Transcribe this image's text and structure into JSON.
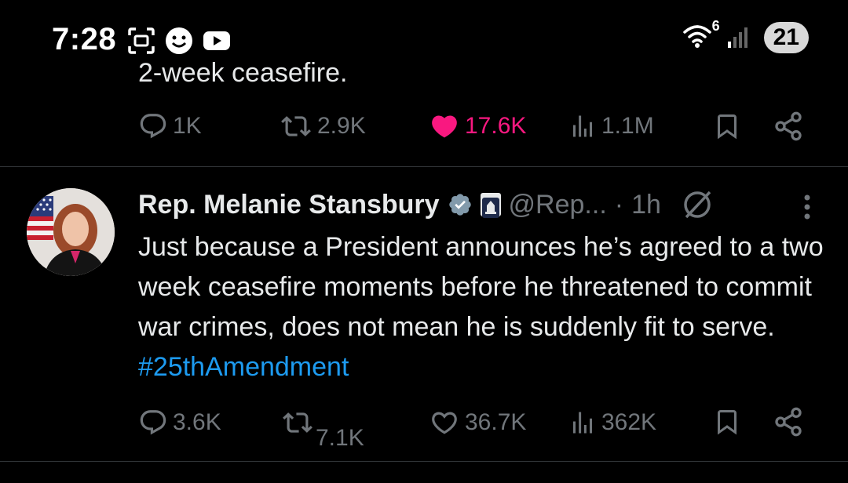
{
  "status_bar": {
    "time": "7:28",
    "wifi_label": "6",
    "battery": "21"
  },
  "previous_tweet": {
    "text_fragment": "2-week ceasefire.",
    "actions": {
      "replies": "1K",
      "reposts": "2.9K",
      "likes": "17.6K",
      "views": "1.1M"
    },
    "liked": true
  },
  "tweet": {
    "author_name": "Rep. Melanie Stansbury",
    "handle": "@Rep...",
    "separator": "·",
    "time": "1h",
    "text": "Just because a President announces he’s agreed to a two week ceasefire moments before he threatened to commit war crimes, does not mean he is suddenly fit to serve.",
    "hashtag": "#25thAmendment",
    "actions": {
      "replies": "3.6K",
      "reposts": "7.1K",
      "likes": "36.7K",
      "views": "362K"
    }
  },
  "colors": {
    "background": "#000000",
    "text": "#e7e9ea",
    "muted": "#71767b",
    "like": "#f91880",
    "link": "#1d9bf0",
    "divider": "#2f3336"
  }
}
